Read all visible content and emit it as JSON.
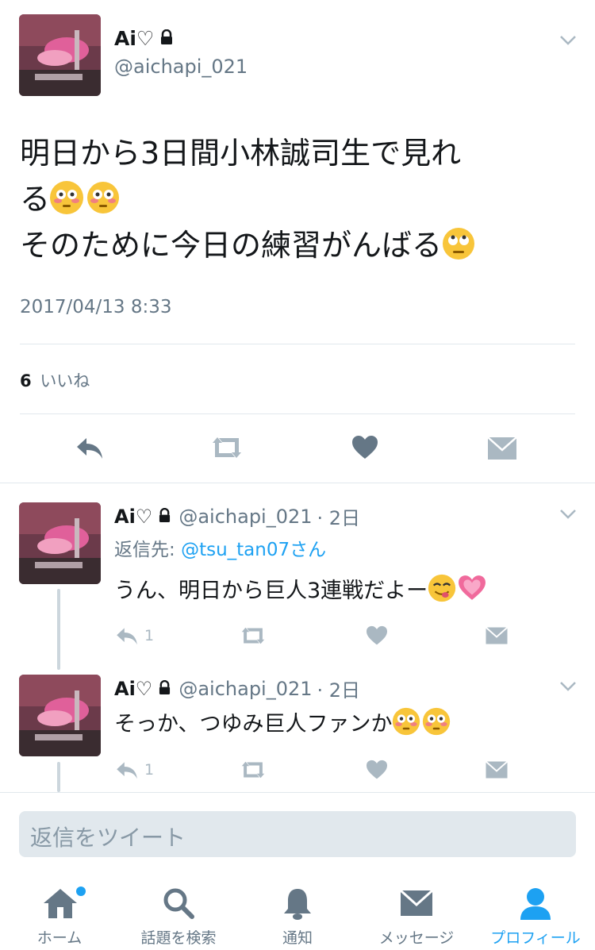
{
  "main_tweet": {
    "display_name": "Ai♡",
    "handle": "@aichapi_021",
    "text_line1": "明日から3日間小林誠司生で見れ",
    "text_line2": "る",
    "text_line3": "そのために今日の練習がんばる",
    "timestamp": "2017/04/13 8:33",
    "likes_count": "6",
    "likes_label": "いいね"
  },
  "replies": [
    {
      "display_name": "Ai♡",
      "handle": "@aichapi_021",
      "time": "· 2日",
      "reply_to_label": "返信先: ",
      "reply_to_user": "@tsu_tan07さん",
      "text": "うん、明日から巨人3連戦だよー",
      "reply_count": "1"
    },
    {
      "display_name": "Ai♡",
      "handle": "@aichapi_021",
      "time": "· 2日",
      "text": "そっか、つゆみ巨人ファンか",
      "reply_count": "1"
    }
  ],
  "reply_input": {
    "placeholder": "返信をツイート"
  },
  "tab_bar": {
    "home": "ホーム",
    "search": "話題を検索",
    "notifications": "通知",
    "messages": "メッセージ",
    "profile": "プロフィール"
  },
  "colors": {
    "accent": "#1da1f2",
    "icon_gray": "#657786",
    "light_gray": "#aab8c2"
  }
}
